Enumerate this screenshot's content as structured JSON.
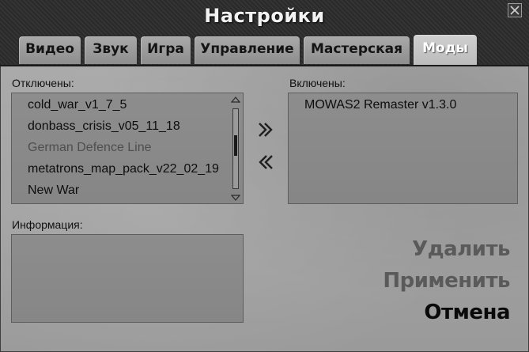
{
  "window": {
    "title": "Настройки"
  },
  "tabs": [
    {
      "label": "Видео",
      "active": false
    },
    {
      "label": "Звук",
      "active": false
    },
    {
      "label": "Игра",
      "active": false
    },
    {
      "label": "Управление",
      "active": false
    },
    {
      "label": "Мастерская",
      "active": false
    },
    {
      "label": "Моды",
      "active": true
    }
  ],
  "disabled_panel": {
    "label": "Отключены:",
    "items": [
      {
        "name": "cold_war_v1_7_5",
        "available": true
      },
      {
        "name": "donbass_crisis_v05_11_18",
        "available": true
      },
      {
        "name": "German Defence Line",
        "available": false
      },
      {
        "name": "metatrons_map_pack_v22_02_19",
        "available": true
      },
      {
        "name": "New War",
        "available": true
      }
    ]
  },
  "enabled_panel": {
    "label": "Включены:",
    "items": [
      "MOWAS2 Remaster v1.3.0"
    ]
  },
  "info_panel": {
    "label": "Информация:"
  },
  "actions": {
    "delete": "Удалить",
    "apply": "Применить",
    "cancel": "Отмена"
  },
  "colors": {
    "header": "#2e2e2e",
    "tab_active_text": "#ffffff",
    "action_inactive": "#5a5a5a",
    "action_active": "#0a0a0a"
  }
}
